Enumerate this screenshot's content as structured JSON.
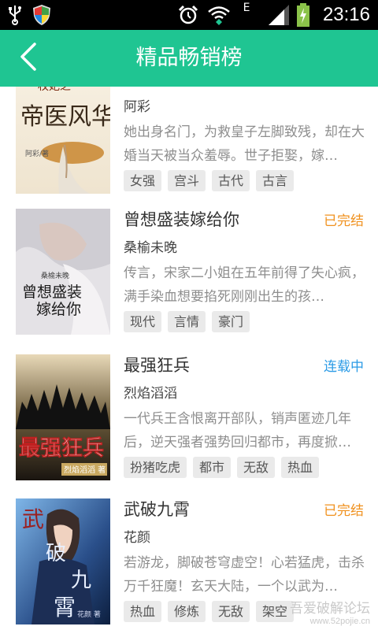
{
  "statusbar": {
    "time": "23:16",
    "network_label": "E",
    "icons": [
      "usb-icon",
      "shield-icon",
      "alarm-icon",
      "wifi-icon",
      "signal-icon",
      "battery-charging-icon"
    ]
  },
  "appbar": {
    "title": "精品畅销榜",
    "back_icon": "chevron-left-icon",
    "color": "#1fc592"
  },
  "books": [
    {
      "title": "",
      "author": "阿彩",
      "status": "",
      "desc": "她出身名门，为救皇子左脚致残，却在大婚当天被当众羞辱。世子拒娶，嫁…",
      "tags": [
        "女强",
        "宫斗",
        "古代",
        "古言"
      ],
      "cover_text": "帝医风华",
      "cover_top_text": "权妃之",
      "cover_author": "阿彩/著"
    },
    {
      "title": "曾想盛装嫁给你",
      "author": "桑榆未晚",
      "status": "已完结",
      "status_color": "#f0911e",
      "desc": "传言，宋家二小姐在五年前得了失心疯，满手染血想要掐死刚刚出生的孩…",
      "tags": [
        "现代",
        "言情",
        "豪门"
      ],
      "cover_text": "曾想盛装嫁给你",
      "cover_top_text": "桑榆未晚"
    },
    {
      "title": "最强狂兵",
      "author": "烈焰滔滔",
      "status": "连载中",
      "status_color": "#2b9be6",
      "desc": "一代兵王含恨离开部队，销声匿迹几年后，逆天强者强势回归都市，再度掀…",
      "tags": [
        "扮猪吃虎",
        "都市",
        "无敌",
        "热血"
      ],
      "cover_text": "最强狂兵",
      "cover_author": "烈焰滔滔 著"
    },
    {
      "title": "武破九霄",
      "author": "花颜",
      "status": "已完结",
      "status_color": "#f0911e",
      "desc": "若游龙，脚破苍穹虚空！心若猛虎，击杀万千狂魔！玄天大陆，一个以武为…",
      "tags": [
        "热血",
        "修炼",
        "无敌",
        "架空"
      ],
      "cover_text": "武破九霄",
      "cover_author": "花颜 著"
    }
  ],
  "watermark": {
    "line1": "吾爱破解论坛",
    "line2": "www.52pojie.cn"
  }
}
